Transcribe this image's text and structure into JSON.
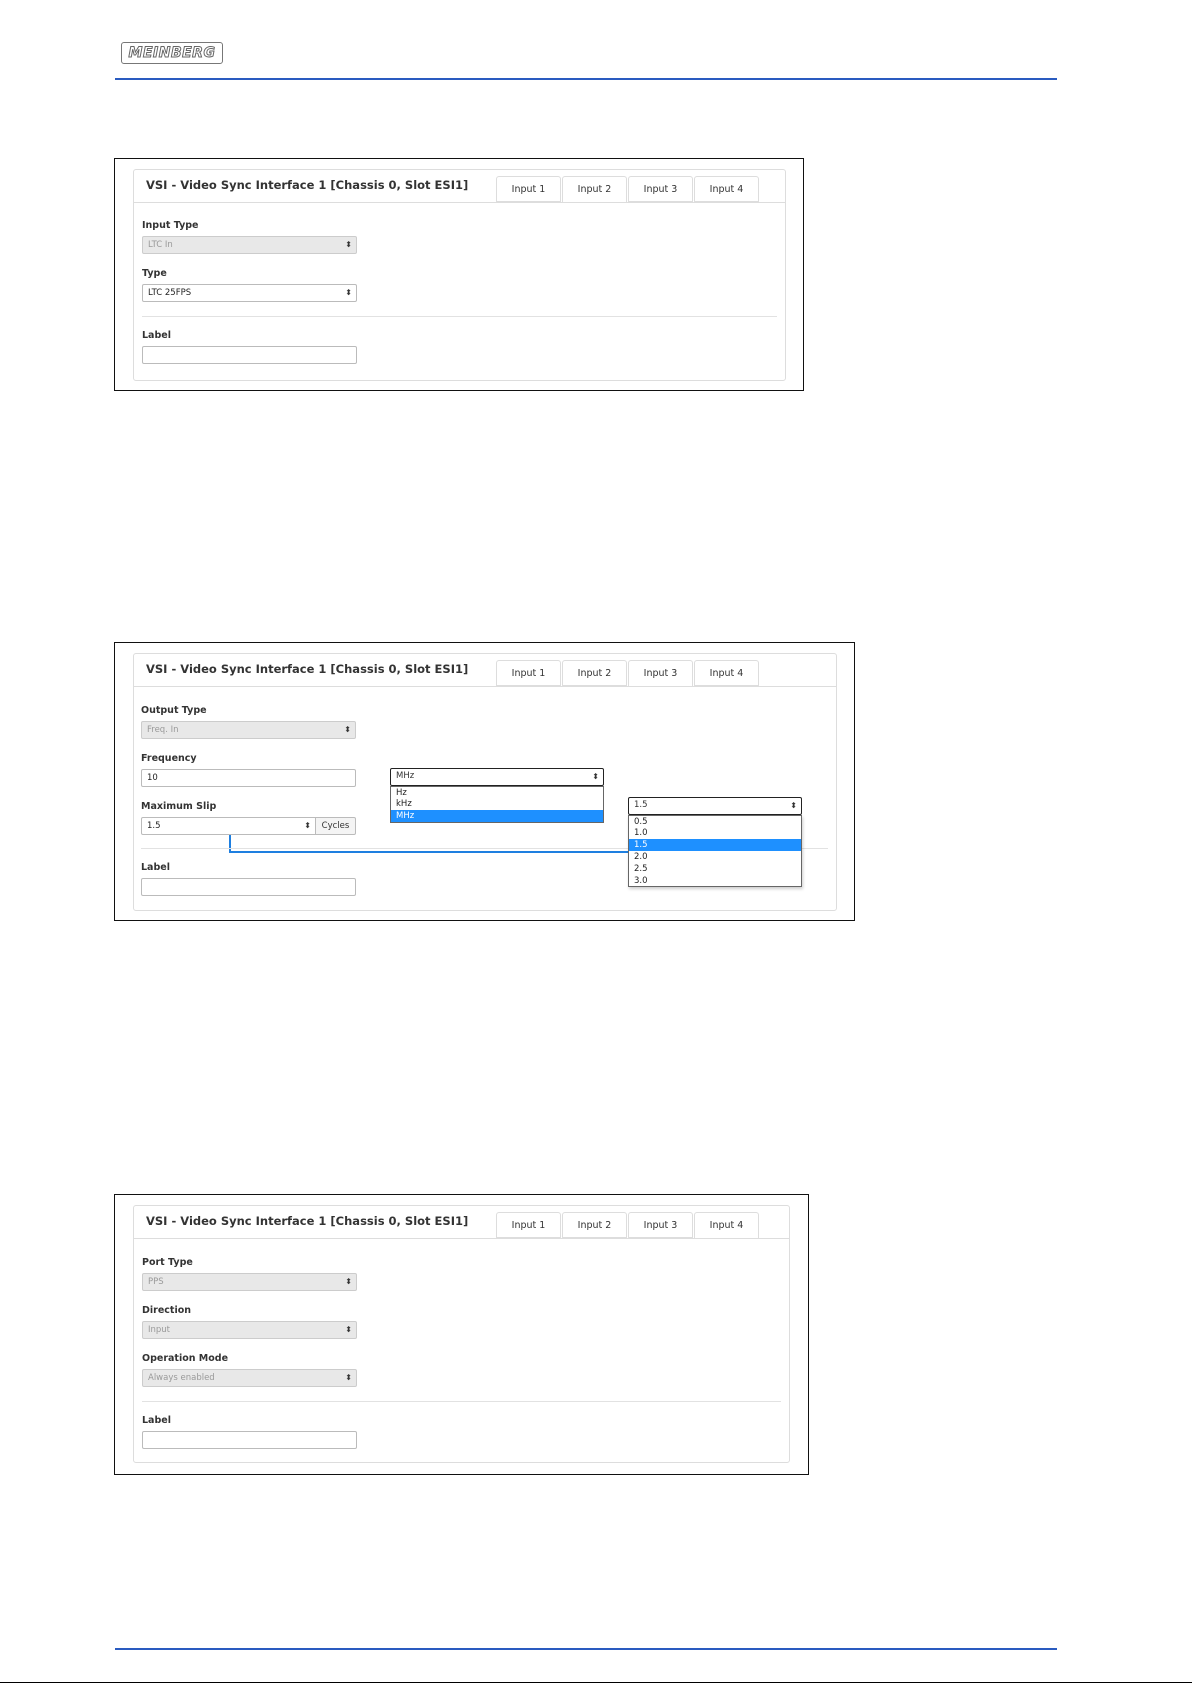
{
  "brand": {
    "logo_text": "MEINBERG"
  },
  "panel_title": "VSI - Video Sync Interface 1 [Chassis 0, Slot ESI1]",
  "tabs": [
    "Input 1",
    "Input 2",
    "Input 3",
    "Input 4"
  ],
  "shot1": {
    "active_tab": "Input 2",
    "input_type_label": "Input Type",
    "input_type_value": "LTC In",
    "type_label": "Type",
    "type_value": "LTC 25FPS",
    "label_label": "Label",
    "label_value": ""
  },
  "shot2": {
    "active_tab": "Input 3",
    "output_type_label": "Output Type",
    "output_type_value": "Freq. In",
    "frequency_label": "Frequency",
    "frequency_value": "10",
    "unit_select_value": "MHz",
    "unit_options": [
      "Hz",
      "kHz",
      "MHz"
    ],
    "unit_selected": "MHz",
    "max_slip_label": "Maximum Slip",
    "max_slip_value": "1.5",
    "max_slip_addon": "Cycles",
    "slip_select_value": "1.5",
    "slip_options": [
      "0.5",
      "1.0",
      "1.5",
      "2.0",
      "2.5",
      "3.0"
    ],
    "slip_selected": "1.5",
    "label_label": "Label",
    "label_value": ""
  },
  "shot3": {
    "active_tab": "Input 4",
    "port_type_label": "Port Type",
    "port_type_value": "PPS",
    "direction_label": "Direction",
    "direction_value": "Input",
    "operation_mode_label": "Operation Mode",
    "operation_mode_value": "Always enabled",
    "label_label": "Label",
    "label_value": ""
  },
  "colors": {
    "accent_rule": "#2a5bc0",
    "highlight": "#1e90ff",
    "connector": "#1e7fe0"
  }
}
